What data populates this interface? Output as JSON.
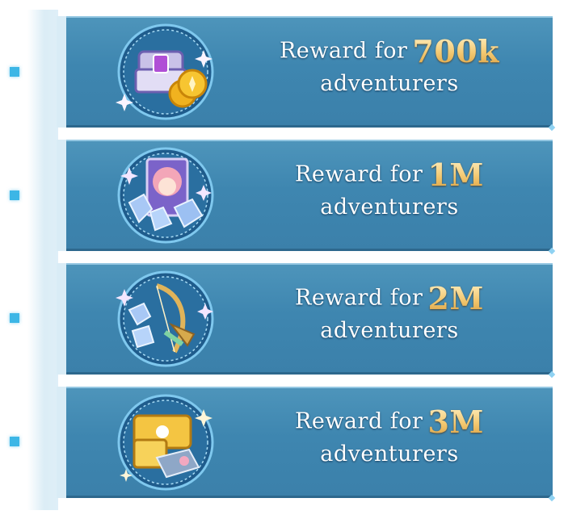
{
  "rewards": [
    {
      "label": "Reward for",
      "amount": "700k",
      "sub": "adventurers",
      "icon": "treasure-chest-coins"
    },
    {
      "label": "Reward for",
      "amount": "1M",
      "sub": "adventurers",
      "icon": "character-portrait-crystals"
    },
    {
      "label": "Reward for",
      "amount": "2M",
      "sub": "adventurers",
      "icon": "harp-bow-crystals"
    },
    {
      "label": "Reward for",
      "amount": "3M",
      "sub": "adventurers",
      "icon": "golden-chest-furniture"
    }
  ],
  "colors": {
    "card": "#3e86b0",
    "amount_gold": "#f3c870",
    "node": "#3cb6e6"
  }
}
